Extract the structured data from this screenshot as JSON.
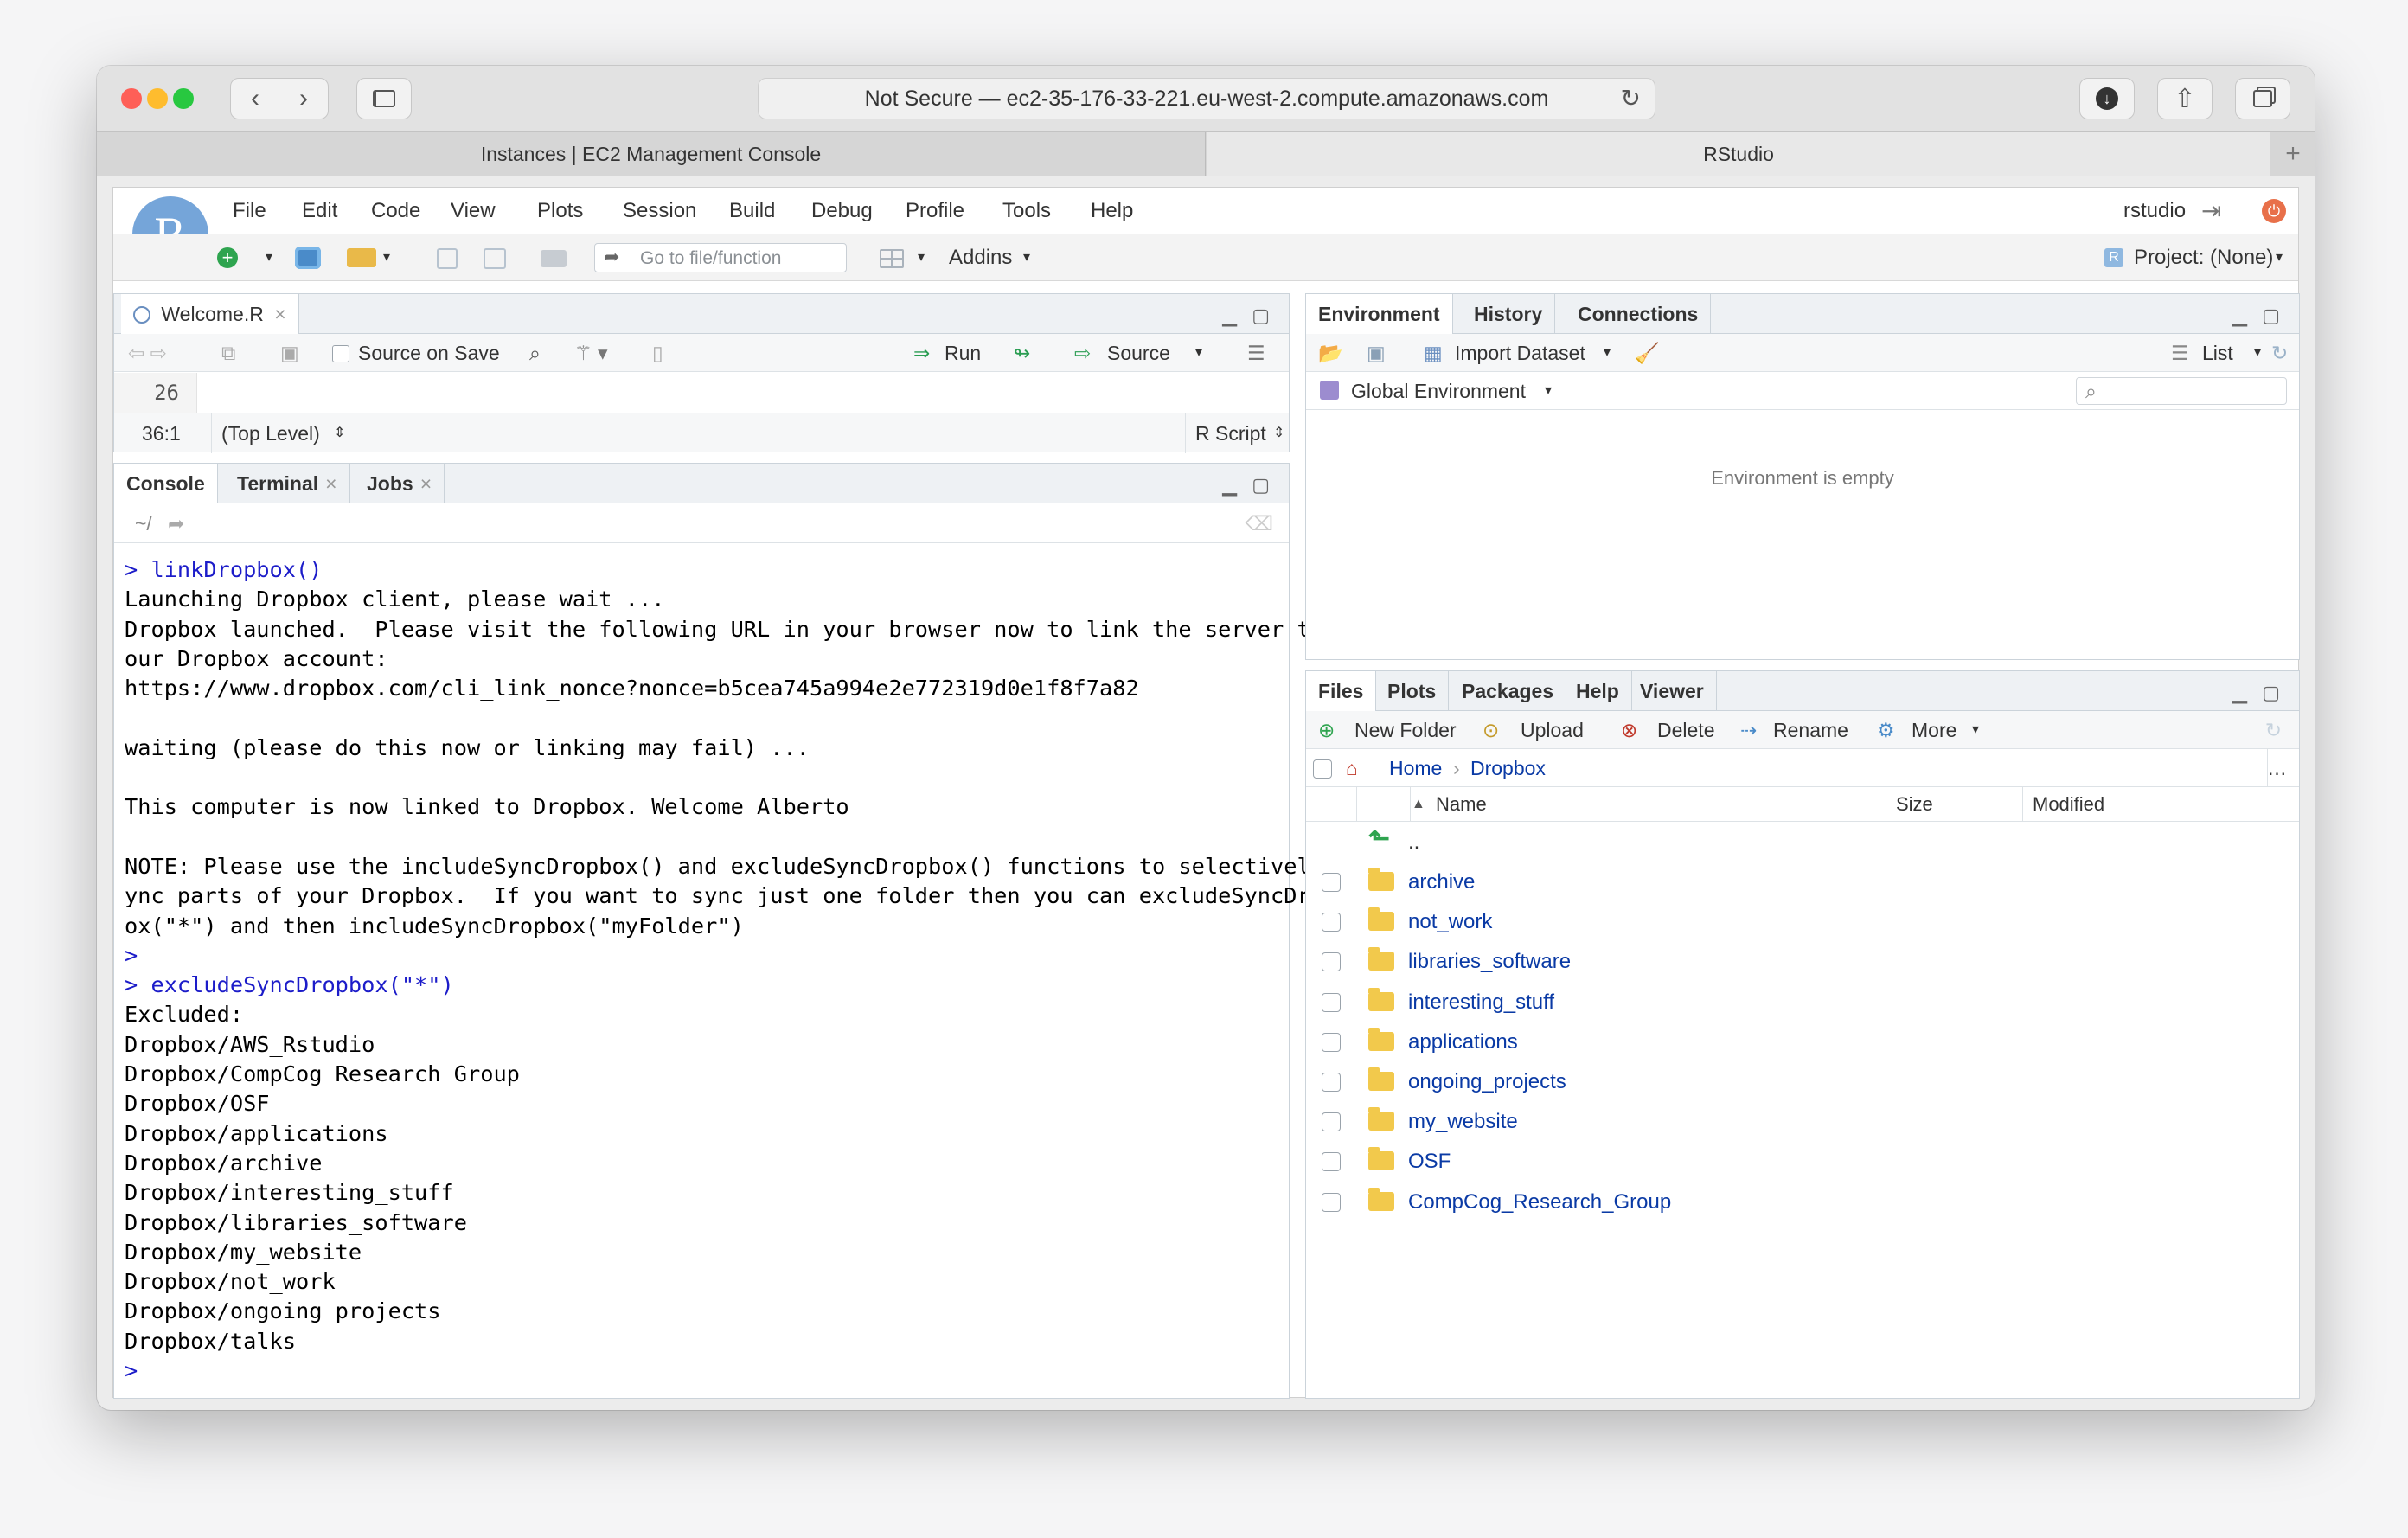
{
  "browser": {
    "url_text": "Not Secure — ec2-35-176-33-221.eu-west-2.compute.amazonaws.com",
    "tabs": [
      "Instances | EC2 Management Console",
      "RStudio"
    ],
    "new_tab": "+"
  },
  "rstudio": {
    "logo_letter": "R",
    "menu": [
      "File",
      "Edit",
      "Code",
      "View",
      "Plots",
      "Session",
      "Build",
      "Debug",
      "Profile",
      "Tools",
      "Help"
    ],
    "user": "rstudio",
    "go_to_file_placeholder": "Go to file/function",
    "addins": "Addins",
    "project": "Project: (None)"
  },
  "source_pane": {
    "tab": "Welcome.R",
    "source_on_save": "Source on Save",
    "run": "Run",
    "source": "Source",
    "line_number": "26",
    "cursor_pos": "36:1",
    "scope": "(Top Level)",
    "file_type": "R Script"
  },
  "console_pane": {
    "tabs": [
      "Console",
      "Terminal",
      "Jobs"
    ],
    "path": "~/",
    "lines": [
      {
        "t": "> linkDropbox()",
        "in": true
      },
      {
        "t": "Launching Dropbox client, please wait ...",
        "in": false
      },
      {
        "t": "Dropbox launched.  Please visit the following URL in your browser now to link the server to y",
        "in": false
      },
      {
        "t": "our Dropbox account:",
        "in": false
      },
      {
        "t": "https://www.dropbox.com/cli_link_nonce?nonce=b5cea745a994e2e772319d0e1f8f7a82",
        "in": false
      },
      {
        "t": "",
        "in": false
      },
      {
        "t": "waiting (please do this now or linking may fail) ...",
        "in": false
      },
      {
        "t": "",
        "in": false
      },
      {
        "t": "This computer is now linked to Dropbox. Welcome Alberto",
        "in": false
      },
      {
        "t": "",
        "in": false
      },
      {
        "t": "NOTE: Please use the includeSyncDropbox() and excludeSyncDropbox() functions to selectively s",
        "in": false
      },
      {
        "t": "ync parts of your Dropbox.  If you want to sync just one folder then you can excludeSyncDropb",
        "in": false
      },
      {
        "t": "ox(\"*\") and then includeSyncDropbox(\"myFolder\")",
        "in": false
      },
      {
        "t": ">",
        "in": true
      },
      {
        "t": "> excludeSyncDropbox(\"*\")",
        "in": true
      },
      {
        "t": "Excluded:",
        "in": false
      },
      {
        "t": "Dropbox/AWS_Rstudio",
        "in": false
      },
      {
        "t": "Dropbox/CompCog_Research_Group",
        "in": false
      },
      {
        "t": "Dropbox/OSF",
        "in": false
      },
      {
        "t": "Dropbox/applications",
        "in": false
      },
      {
        "t": "Dropbox/archive",
        "in": false
      },
      {
        "t": "Dropbox/interesting_stuff",
        "in": false
      },
      {
        "t": "Dropbox/libraries_software",
        "in": false
      },
      {
        "t": "Dropbox/my_website",
        "in": false
      },
      {
        "t": "Dropbox/not_work",
        "in": false
      },
      {
        "t": "Dropbox/ongoing_projects",
        "in": false
      },
      {
        "t": "Dropbox/talks",
        "in": false
      },
      {
        "t": ">",
        "in": true
      }
    ]
  },
  "env_pane": {
    "tabs": [
      "Environment",
      "History",
      "Connections"
    ],
    "import_dataset": "Import Dataset",
    "list": "List",
    "global_env": "Global Environment",
    "empty_msg": "Environment is empty"
  },
  "files_pane": {
    "tabs": [
      "Files",
      "Plots",
      "Packages",
      "Help",
      "Viewer"
    ],
    "new_folder": "New Folder",
    "upload": "Upload",
    "delete": "Delete",
    "rename": "Rename",
    "more": "More",
    "crumb_home": "Home",
    "crumb_dir": "Dropbox",
    "col_name": "Name",
    "col_size": "Size",
    "col_modified": "Modified",
    "parent": "..",
    "items": [
      "archive",
      "not_work",
      "libraries_software",
      "interesting_stuff",
      "applications",
      "ongoing_projects",
      "my_website",
      "OSF",
      "CompCog_Research_Group"
    ]
  }
}
